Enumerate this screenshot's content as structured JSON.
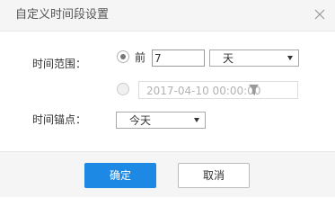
{
  "dialog": {
    "title": "自定义时间段设置",
    "close_icon": "close-icon"
  },
  "form": {
    "time_range_label": "时间范围：",
    "relative_option": {
      "selected": true,
      "prefix": "前",
      "value": "7",
      "unit": "天"
    },
    "absolute_option": {
      "selected": false,
      "disabled": true,
      "placeholder": "2017-04-10 00:00:00",
      "icon": "filter-icon"
    },
    "anchor_label": "时间锚点：",
    "anchor_value": "今天"
  },
  "footer": {
    "confirm_label": "确定",
    "cancel_label": "取消"
  },
  "colors": {
    "primary": "#1e88e5",
    "header_bg": "#f5f5f5",
    "footer_bg": "#f5f5f5"
  }
}
